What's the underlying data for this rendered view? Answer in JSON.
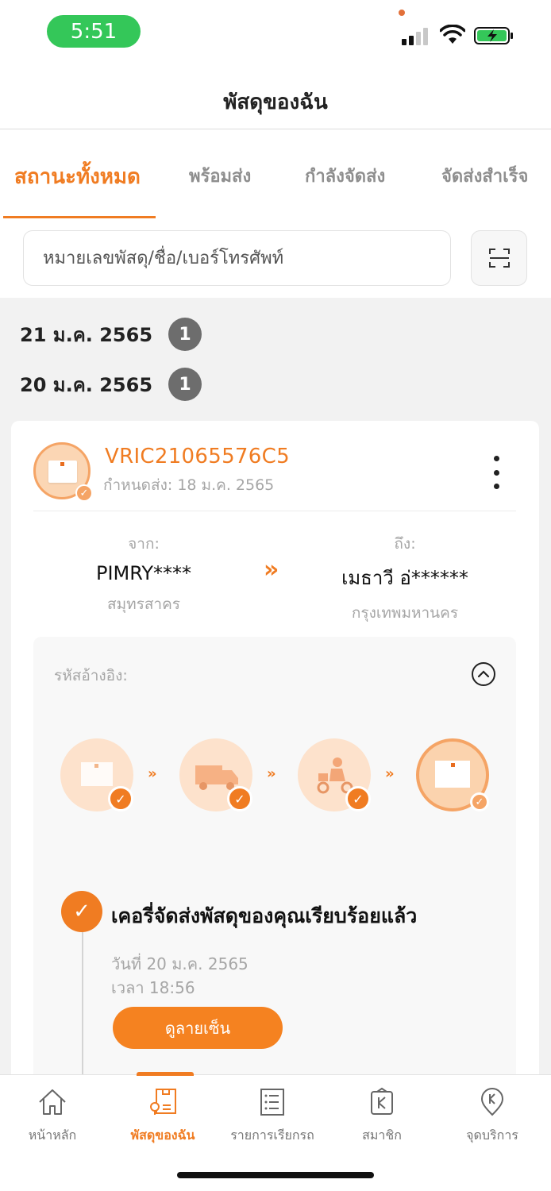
{
  "status_bar": {
    "time": "5:51"
  },
  "header": {
    "title": "พัสดุของฉัน"
  },
  "tabs": [
    {
      "label": "สถานะทั้งหมด",
      "active": true
    },
    {
      "label": "พร้อมส่ง",
      "active": false
    },
    {
      "label": "กำลังจัดส่ง",
      "active": false
    },
    {
      "label": "จัดส่งสำเร็จ",
      "active": false
    }
  ],
  "search": {
    "placeholder": "หมายเลขพัสดุ/ชื่อ/เบอร์โทรศัพท์"
  },
  "date_groups": [
    {
      "date": "21 ม.ค. 2565",
      "count": "1"
    },
    {
      "date": "20 ม.ค. 2565",
      "count": "1"
    }
  ],
  "parcel": {
    "tracking_number": "VRIC21065576C5",
    "due_date": "กำหนดส่ง: 18 ม.ค. 2565",
    "sender": {
      "label": "จาก:",
      "name": "PIMRY****",
      "city": "สมุทรสาคร"
    },
    "arrow": "»",
    "recipient": {
      "label": "ถึง:",
      "name": "เมธาวี อ่******",
      "city": "กรุงเทพมหานคร"
    },
    "reference_label": "รหัสอ้างอิง:",
    "event": {
      "title": "เคอรี่จัดส่งพัสดุของคุณเรียบร้อยแล้ว",
      "date": "วันที่ 20 ม.ค. 2565",
      "time": "เวลา 18:56",
      "button_label": "ดูลายเซ็น"
    }
  },
  "bottom_nav": [
    {
      "label": "หน้าหลัก",
      "icon": "home-icon",
      "active": false
    },
    {
      "label": "พัสดุของฉัน",
      "icon": "parcel-icon",
      "active": true
    },
    {
      "label": "รายการเรียกรถ",
      "icon": "list-icon",
      "active": false
    },
    {
      "label": "สมาชิก",
      "icon": "member-icon",
      "active": false
    },
    {
      "label": "จุดบริการ",
      "icon": "location-icon",
      "active": false
    }
  ],
  "colors": {
    "accent": "#f07c22",
    "status_pill": "#34c759"
  }
}
